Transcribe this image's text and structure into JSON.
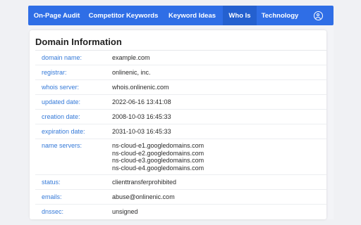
{
  "nav": {
    "tabs": [
      {
        "label": "On-Page Audit",
        "active": false
      },
      {
        "label": "Competitor Keywords",
        "active": false
      },
      {
        "label": "Keyword Ideas",
        "active": false
      },
      {
        "label": "Who Is",
        "active": true
      },
      {
        "label": "Technology",
        "active": false
      }
    ],
    "user_icon": "user-circle-icon"
  },
  "card": {
    "title": "Domain Information",
    "fields": [
      {
        "label": "domain name:",
        "value": "example.com"
      },
      {
        "label": "registrar:",
        "value": "onlinenic, inc."
      },
      {
        "label": "whois server:",
        "value": "whois.onlinenic.com"
      },
      {
        "label": "updated date:",
        "value": "2022-06-16 13:41:08"
      },
      {
        "label": "creation date:",
        "value": "2008-10-03 16:45:33"
      },
      {
        "label": "expiration date:",
        "value": "2031-10-03 16:45:33"
      },
      {
        "label": "name servers:",
        "values": [
          "ns-cloud-e1.googledomains.com",
          "ns-cloud-e2.googledomains.com",
          "ns-cloud-e3.googledomains.com",
          "ns-cloud-e4.googledomains.com"
        ]
      },
      {
        "label": "status:",
        "value": "clienttransferprohibited"
      },
      {
        "label": "emails:",
        "value": "abuse@onlinenic.com"
      },
      {
        "label": "dnssec:",
        "value": "unsigned"
      }
    ]
  },
  "colors": {
    "nav_bg": "#2f6ee6",
    "nav_active": "#2460cf",
    "label": "#3479d8"
  }
}
